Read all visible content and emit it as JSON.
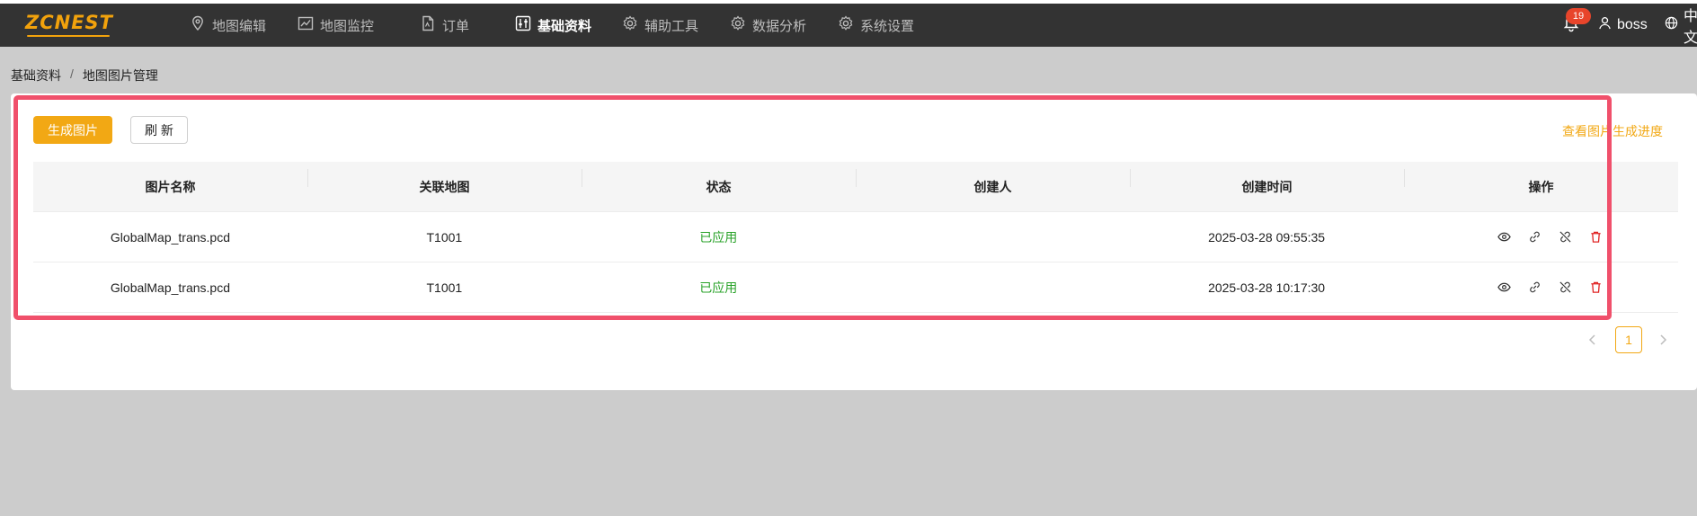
{
  "app": {
    "logo_text": "ZCNEST",
    "colors": {
      "nav_bg": "#333333",
      "accent": "#f2a814",
      "status_green": "#28a228",
      "delete_red": "#e02424",
      "highlight": "#f0506b"
    }
  },
  "nav": {
    "items": [
      {
        "label": "地图编辑",
        "icon": "map-pin-icon"
      },
      {
        "label": "地图监控",
        "icon": "line-chart-icon"
      },
      {
        "label": "订单",
        "icon": "document-icon"
      },
      {
        "label": "基础资料",
        "icon": "sliders-icon",
        "active": true
      },
      {
        "label": "辅助工具",
        "icon": "gear-icon"
      },
      {
        "label": "数据分析",
        "icon": "gear-icon"
      },
      {
        "label": "系统设置",
        "icon": "gear-icon"
      }
    ]
  },
  "header": {
    "notification_count": "19",
    "username": "boss",
    "language": "中文"
  },
  "breadcrumb": {
    "root": "基础资料",
    "separator": "/",
    "current": "地图图片管理"
  },
  "toolbar": {
    "generate_label": "生成图片",
    "refresh_label": "刷 新",
    "progress_link": "查看图片生成进度"
  },
  "table": {
    "columns": [
      "图片名称",
      "关联地图",
      "状态",
      "创建人",
      "创建时间",
      "操作"
    ],
    "rows": [
      {
        "name": "GlobalMap_trans.pcd",
        "map": "T1001",
        "status": "已应用",
        "creator": "",
        "created": "2025-03-28 09:55:35"
      },
      {
        "name": "GlobalMap_trans.pcd",
        "map": "T1001",
        "status": "已应用",
        "creator": "",
        "created": "2025-03-28 10:17:30"
      }
    ],
    "row_actions": [
      "view-icon",
      "link-icon",
      "unlink-icon",
      "delete-icon"
    ]
  },
  "pagination": {
    "current_page": "1"
  }
}
